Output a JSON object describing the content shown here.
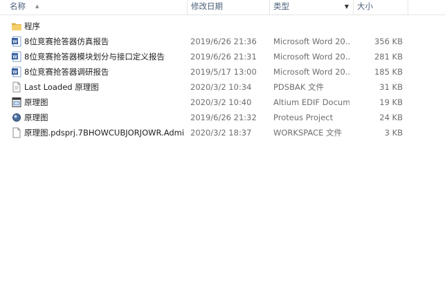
{
  "columns": {
    "name": "名称",
    "date": "修改日期",
    "type": "类型",
    "size": "大小"
  },
  "files": [
    {
      "name": "程序",
      "date": "",
      "type": "",
      "size": "",
      "icon": "folder-icon"
    },
    {
      "name": "8位竞赛抢答器仿真报告",
      "date": "2019/6/26 21:36",
      "type": "Microsoft Word 20...",
      "size": "356 KB",
      "icon": "word-doc-icon"
    },
    {
      "name": "8位竞赛抢答器模块划分与接口定义报告",
      "date": "2019/6/26 21:31",
      "type": "Microsoft Word 20...",
      "size": "281 KB",
      "icon": "word-doc-icon"
    },
    {
      "name": "8位竞赛抢答器调研报告",
      "date": "2019/5/17 13:00",
      "type": "Microsoft Word 20...",
      "size": "185 KB",
      "icon": "word-doc-icon"
    },
    {
      "name": "Last Loaded 原理图",
      "date": "2020/3/2 10:34",
      "type": "PDSBAK 文件",
      "size": "31 KB",
      "icon": "pdsbak-file-icon"
    },
    {
      "name": "原理图",
      "date": "2020/3/2 10:40",
      "type": "Altium EDIF Docum...",
      "size": "19 KB",
      "icon": "altium-edif-icon"
    },
    {
      "name": "原理图",
      "date": "2019/6/26 21:32",
      "type": "Proteus Project",
      "size": "24 KB",
      "icon": "proteus-project-icon"
    },
    {
      "name": "原理图.pdsprj.7BHOWCUBJORJOWR.Admi...",
      "date": "2020/3/2 18:37",
      "type": "WORKSPACE 文件",
      "size": "3 KB",
      "icon": "workspace-file-icon"
    }
  ]
}
